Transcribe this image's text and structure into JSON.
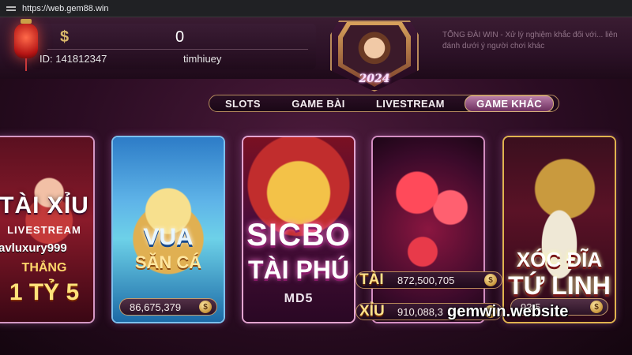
{
  "browser": {
    "url": "https://web.gem88.win"
  },
  "header": {
    "balance": "0",
    "user_id": "ID: 141812347",
    "username": "timhiuey",
    "year_badge": "2024",
    "marquee": "TỔNG ĐÀI WIN - Xử lý nghiệm khắc đối với... liên đánh dưới ý người chơi khác"
  },
  "tabs": [
    {
      "label": "SLOTS",
      "active": false
    },
    {
      "label": "GAME BÀI",
      "active": false
    },
    {
      "label": "LIVESTREAM",
      "active": false
    },
    {
      "label": "GAME KHÁC",
      "active": true
    }
  ],
  "games": {
    "taixiu_live": {
      "title": "TÀI XỈU",
      "subtitle": "LIVESTREAM",
      "streamer": "avluxury999",
      "win_label": "THẮNG",
      "prize": "1 TỶ 5"
    },
    "vua_san_ca": {
      "title1": "VUA",
      "title2": "SĂN CÁ",
      "jackpot": "86,675,379"
    },
    "sicbo": {
      "title1": "SICBO",
      "title2": "TÀI PHÚ",
      "variant": "MD5"
    },
    "dice": {
      "tai_label": "TÀI",
      "tai_value": "872,500,705",
      "xiu_label": "XỈU",
      "xiu_value": "910,088,3"
    },
    "xoc_dia": {
      "title1": "XÓC ĐĨA",
      "title2": "TỨ LINH",
      "jackpot": "93,5"
    }
  },
  "watermark": "gemwin.website",
  "icons": {
    "currency": "dollar-icon",
    "coin": "coin-icon",
    "lantern": "lantern-icon"
  },
  "colors": {
    "accent_gold": "#c49a6b",
    "tab_active": "#b97ea8",
    "background": "#2a0c22"
  }
}
